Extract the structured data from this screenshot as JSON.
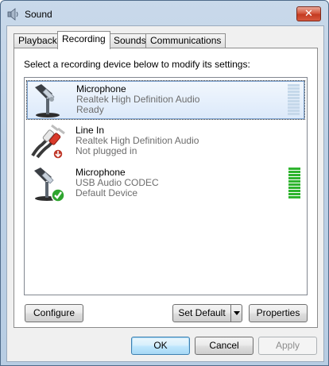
{
  "window": {
    "title": "Sound",
    "close_glyph": "✕"
  },
  "tabs": [
    {
      "label": "Playback",
      "active": false
    },
    {
      "label": "Recording",
      "active": true
    },
    {
      "label": "Sounds",
      "active": false
    },
    {
      "label": "Communications",
      "active": false
    }
  ],
  "recording": {
    "instructions": "Select a recording device below to modify its settings:",
    "devices": [
      {
        "name": "Microphone",
        "driver": "Realtek High Definition Audio",
        "status": "Ready",
        "icon": "microphone-icon",
        "selected": true,
        "level": 0
      },
      {
        "name": "Line In",
        "driver": "Realtek High Definition Audio",
        "status": "Not plugged in",
        "icon": "line-in-jack-icon",
        "selected": false,
        "level": null
      },
      {
        "name": "Microphone",
        "driver": "USB Audio CODEC",
        "status": "Default Device",
        "icon": "microphone-default-icon",
        "selected": false,
        "level": 1.0
      }
    ],
    "configure_label": "Configure",
    "set_default_label": "Set Default",
    "properties_label": "Properties"
  },
  "footer": {
    "ok_label": "OK",
    "cancel_label": "Cancel",
    "apply_label": "Apply"
  },
  "colors": {
    "meter_on": "#2fb42f",
    "meter_off": "#c5d8ea",
    "default_check": "#2fa52f",
    "unplugged_badge": "#c0392b"
  }
}
